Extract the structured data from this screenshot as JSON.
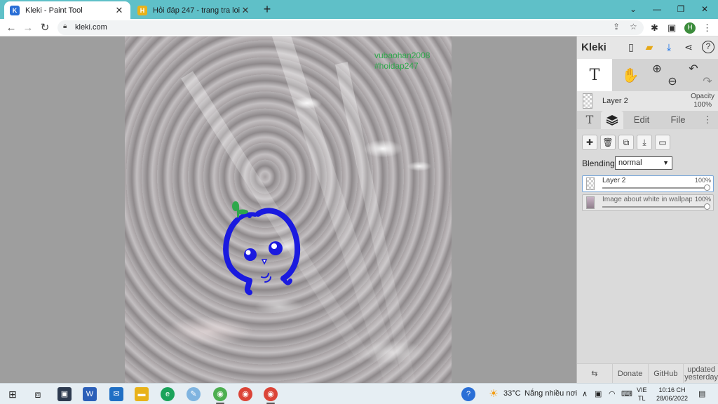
{
  "browser": {
    "tabs": [
      {
        "title": "Kleki - Paint Tool",
        "active": true
      },
      {
        "title": "Hỏi đáp 247 - trang tra loi",
        "active": false
      }
    ],
    "new_tab": "+",
    "window_controls": {
      "minimize": "⌄",
      "restore": "—",
      "maximize": "❐",
      "close": "✕"
    },
    "url": "kleki.com",
    "profile_initial": "H"
  },
  "canvas": {
    "signature_line1": "vubaohan2008",
    "signature_line2": "#hoidap247",
    "signature_color": "#2ea84b",
    "drawing_color": "#1a1adf"
  },
  "kleki": {
    "logo": "Kleki",
    "header_icons": [
      "new-file-icon",
      "open-folder-icon",
      "download-icon",
      "share-icon",
      "help-icon"
    ],
    "tools": {
      "text_tool": "T",
      "hand_tool": "✋",
      "zoom_in": "⊕",
      "zoom_out": "⊖",
      "undo": "↶",
      "redo": "↷"
    },
    "current_layer": "Layer 2",
    "opacity_label": "Opacity",
    "opacity_value": "100%",
    "panel_tabs": [
      {
        "label": "T",
        "name": "text"
      },
      {
        "label": "layers",
        "name": "layers"
      },
      {
        "label": "Edit",
        "name": "edit"
      },
      {
        "label": "File",
        "name": "file"
      }
    ],
    "blending_label": "Blending",
    "blending_value": "normal",
    "layers": [
      {
        "name": "Layer 2",
        "opacity": "100%",
        "opacity_fraction": 1.0,
        "selected": true
      },
      {
        "name": "Image about white in wallpaper",
        "opacity": "100%",
        "opacity_fraction": 1.0,
        "selected": false
      }
    ],
    "footer": [
      "Donate",
      "GitHub",
      "updated",
      "yesterday"
    ]
  },
  "taskbar": {
    "weather_temp": "33°C",
    "weather_text": "Nắng nhiều nơi",
    "lang_top": "VIE",
    "lang_bottom": "TL",
    "time": "10:16 CH",
    "date": "28/06/2022"
  }
}
